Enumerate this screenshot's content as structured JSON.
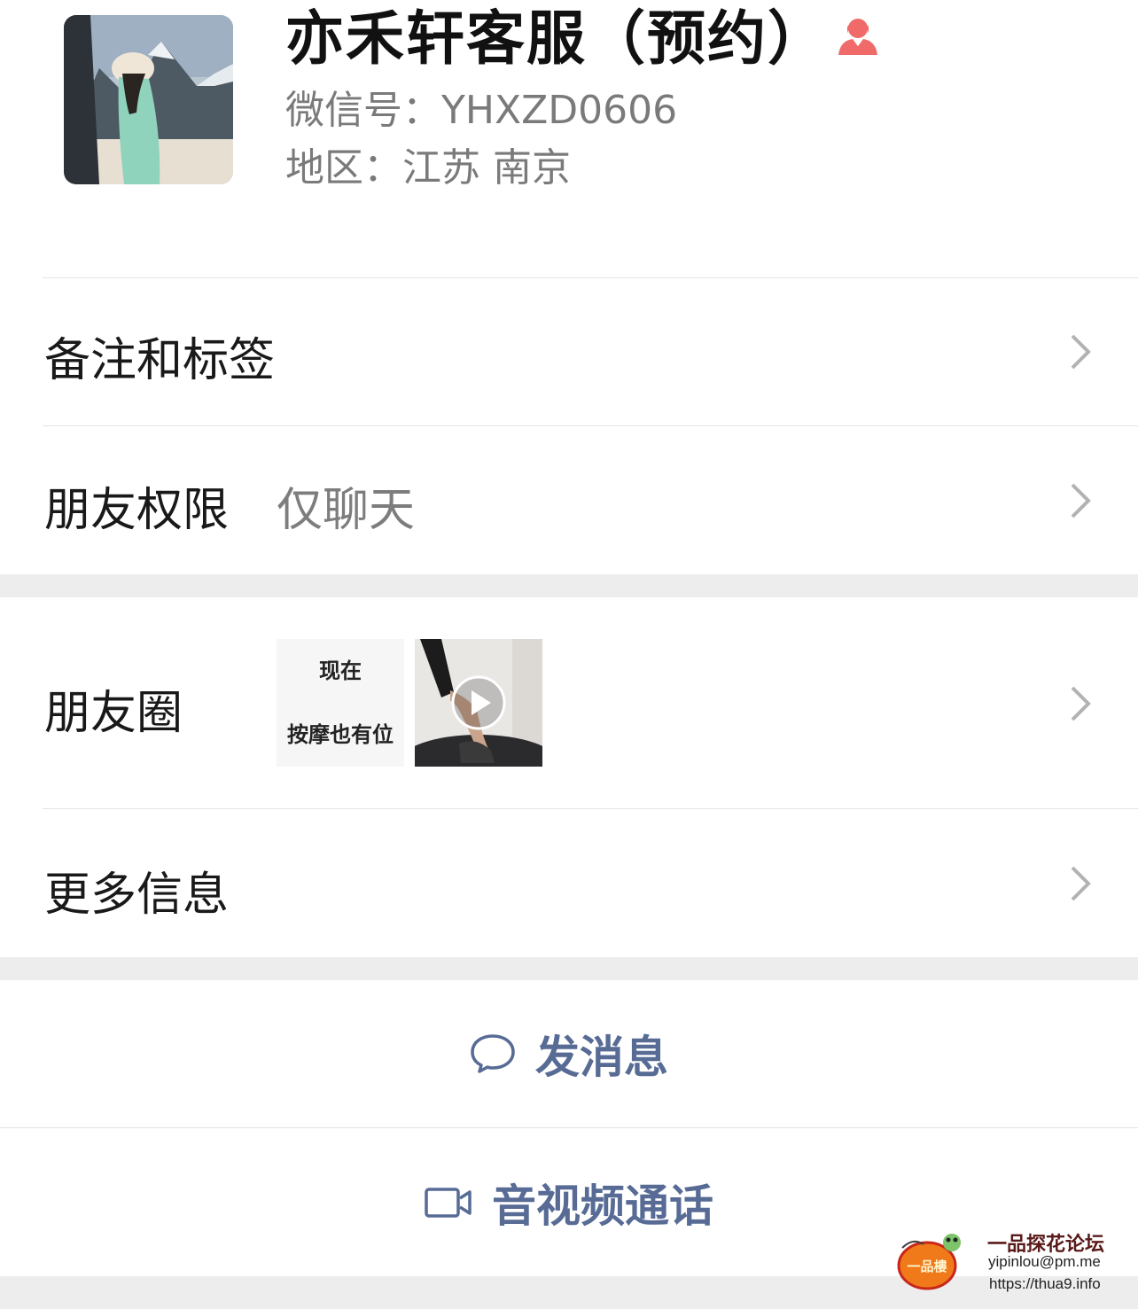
{
  "profile": {
    "name": "亦禾轩客服（预约）",
    "wechat_id": "微信号：YHXZD0606",
    "region": "地区：江苏 南京",
    "gender_icon": "female-icon"
  },
  "rows": {
    "remark_label": "备注和标签",
    "permission_label": "朋友权限",
    "permission_value": "仅聊天",
    "moments_label": "朋友圈",
    "moments_text_line1": "现在",
    "moments_text_line2": "按摩也有位",
    "more_info_label": "更多信息"
  },
  "actions": {
    "message_label": "发消息",
    "message_icon": "chat-bubble-icon",
    "call_label": "音视频通话",
    "call_icon": "video-camera-icon"
  },
  "watermark": {
    "title": "一品探花论坛",
    "logo_text": "一品樓",
    "email": "yipinlou@pm.me",
    "url": "https://thua9.info"
  },
  "colors": {
    "link_blue": "#576b95",
    "gender_pink": "#f06a6a",
    "gap_gray": "#ededed"
  }
}
